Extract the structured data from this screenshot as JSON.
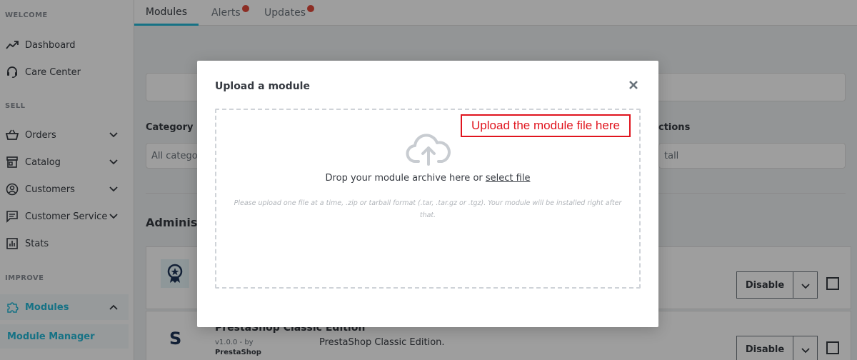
{
  "sidebar": {
    "sections": {
      "welcome": "WELCOME",
      "sell": "SELL",
      "improve": "IMPROVE"
    },
    "items": [
      {
        "label": "Dashboard",
        "icon": "trending-up-icon"
      },
      {
        "label": "Care Center",
        "icon": "headset-icon"
      },
      {
        "label": "Orders",
        "icon": "cart-icon"
      },
      {
        "label": "Catalog",
        "icon": "store-icon"
      },
      {
        "label": "Customers",
        "icon": "user-circle-icon"
      },
      {
        "label": "Customer Service",
        "icon": "chat-icon"
      },
      {
        "label": "Stats",
        "icon": "bar-chart-icon"
      },
      {
        "label": "Modules",
        "icon": "puzzle-icon"
      }
    ],
    "subitem": "Module Manager"
  },
  "tabs": [
    {
      "label": "Modules"
    },
    {
      "label": "Alerts"
    },
    {
      "label": "Updates"
    }
  ],
  "filters": {
    "category_label": "Category",
    "category_value": "All categor",
    "actions_label": "ctions",
    "actions_value": "tall"
  },
  "section_title": "Administ",
  "modules": [
    {
      "name": "",
      "action": "Disable",
      "icon": "badge-icon"
    },
    {
      "name": "PrestaShop Classic Edition",
      "version": "v1.0.0 - by",
      "author": "PrestaShop",
      "description": "PrestaShop Classic Edition.",
      "action": "Disable",
      "icon": "prestashop-logo-icon"
    }
  ],
  "modal": {
    "title": "Upload a module",
    "drop_text": "Drop your module archive here or",
    "select_link": "select file",
    "hint": "Please upload one file at a time, .zip or tarball format (.tar, .tar.gz or .tgz). Your module will be installed right after that.",
    "close_icon": "close-icon",
    "upload_icon": "cloud-upload-icon"
  },
  "annotation": {
    "text": "Upload the module file here",
    "color": "#e0141e"
  },
  "colors": {
    "accent": "#25b9d7",
    "badge": "#e34a3a"
  }
}
